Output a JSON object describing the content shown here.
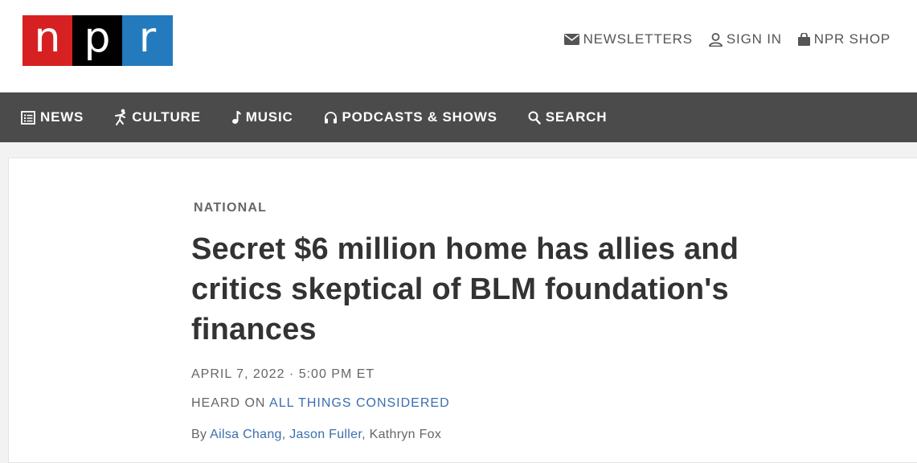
{
  "logo": {
    "letters": [
      "n",
      "p",
      "r"
    ],
    "colors": [
      "#d62021",
      "#000000",
      "#237bbd"
    ]
  },
  "utility_nav": [
    {
      "label": "NEWSLETTERS",
      "icon": "envelope-icon"
    },
    {
      "label": "SIGN IN",
      "icon": "user-icon"
    },
    {
      "label": "NPR SHOP",
      "icon": "shopping-bag-icon"
    }
  ],
  "main_nav": [
    {
      "label": "NEWS",
      "icon": "news-list-icon"
    },
    {
      "label": "CULTURE",
      "icon": "culture-figure-icon"
    },
    {
      "label": "MUSIC",
      "icon": "music-note-icon"
    },
    {
      "label": "PODCASTS & SHOWS",
      "icon": "headphones-icon"
    },
    {
      "label": "SEARCH",
      "icon": "search-icon"
    }
  ],
  "article": {
    "kicker": "NATIONAL",
    "headline": "Secret $6 million home has allies and critics skeptical of BLM foundation's finances",
    "dateline": "APRIL 7, 2022 · 5:00 PM ET",
    "heard_on_prefix": "HEARD ON ",
    "heard_on_show": "ALL THINGS CONSIDERED",
    "byline_prefix": "By ",
    "authors": [
      "Ailsa Chang",
      "Jason Fuller",
      "Kathryn Fox"
    ],
    "separator": ", "
  },
  "colors": {
    "nav_bg": "#4b4b4b",
    "link": "#3b6eaf"
  }
}
